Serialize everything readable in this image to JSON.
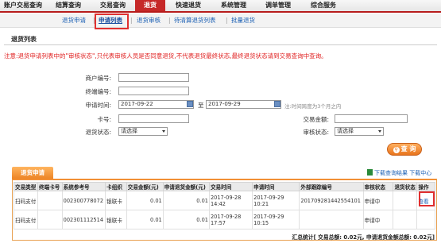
{
  "nav": {
    "items": [
      "账户交易查询",
      "结算查询",
      "交易查询",
      "退货",
      "快速退货",
      "系统管理",
      "调单管理",
      "综合服务"
    ]
  },
  "subnav": {
    "items": [
      "退货申请",
      "申请列表",
      "退货审核",
      "待清算退货列表",
      "批量退货"
    ],
    "separator": "|"
  },
  "section_title": "退货列表",
  "notice": "注意:退货申请列表中的\"审核状态\",只代表审核人员是否同意退货,不代表退货最终状态,最终退货状态请到交易查询中查询。",
  "form": {
    "merchant_no_label": "商户编号:",
    "merchant_no_value": "",
    "terminal_no_label": "终端编号:",
    "terminal_no_value": "",
    "apply_time_label": "申请时间:",
    "apply_time_start": "2017-09-22",
    "apply_time_to": "至",
    "apply_time_end": "2017-09-29",
    "apply_time_tip": "注:时间跨度为3个月之内",
    "card_no_label": "卡号:",
    "card_no_value": "",
    "amount_label": "交易金额:",
    "amount_value": "",
    "refund_status_label": "退货状态:",
    "refund_status_value": "请选择",
    "audit_status_label": "审核状态:",
    "audit_status_value": "请选择"
  },
  "query_button": "查 询",
  "results": {
    "tab_label": "退货申请",
    "download_label": "下载查询结果 下载中心",
    "columns": [
      "交易类型",
      "终端卡号",
      "系统参考号",
      "卡组织",
      "交易金额(元)",
      "申请退货金额(元)",
      "交易时间",
      "申请时间",
      "外部跟踪编号",
      "审核状态",
      "退货状态",
      "操作"
    ],
    "rows": [
      {
        "type": "扫码支付",
        "terminal": "",
        "ref": "002300778072",
        "org": "银联卡",
        "amount": "0.01",
        "refund": "0.01",
        "txn_date": "2017-09-28",
        "txn_time": "14:42",
        "apply_date": "2017-09-29",
        "apply_time": "10:21",
        "ext": "20170928144255410​1",
        "audit": "申请中",
        "refund_status": "",
        "action": "查看"
      },
      {
        "type": "扫码支付",
        "terminal": "",
        "ref": "002301112514",
        "org": "银联卡",
        "amount": "0.01",
        "refund": "0.01",
        "txn_date": "2017-09-28",
        "txn_time": "17:57",
        "apply_date": "2017-09-29",
        "apply_time": "10:15",
        "ext": "",
        "audit": "申请中",
        "refund_status": "",
        "action": ""
      }
    ],
    "summary": "汇总统计[ 交易总额: 0.02元, 申请退货金额总额: 0.02元]"
  },
  "colors": {
    "accent": "#c62828",
    "highlight_box": "#e03030",
    "button": "#e8741c"
  }
}
